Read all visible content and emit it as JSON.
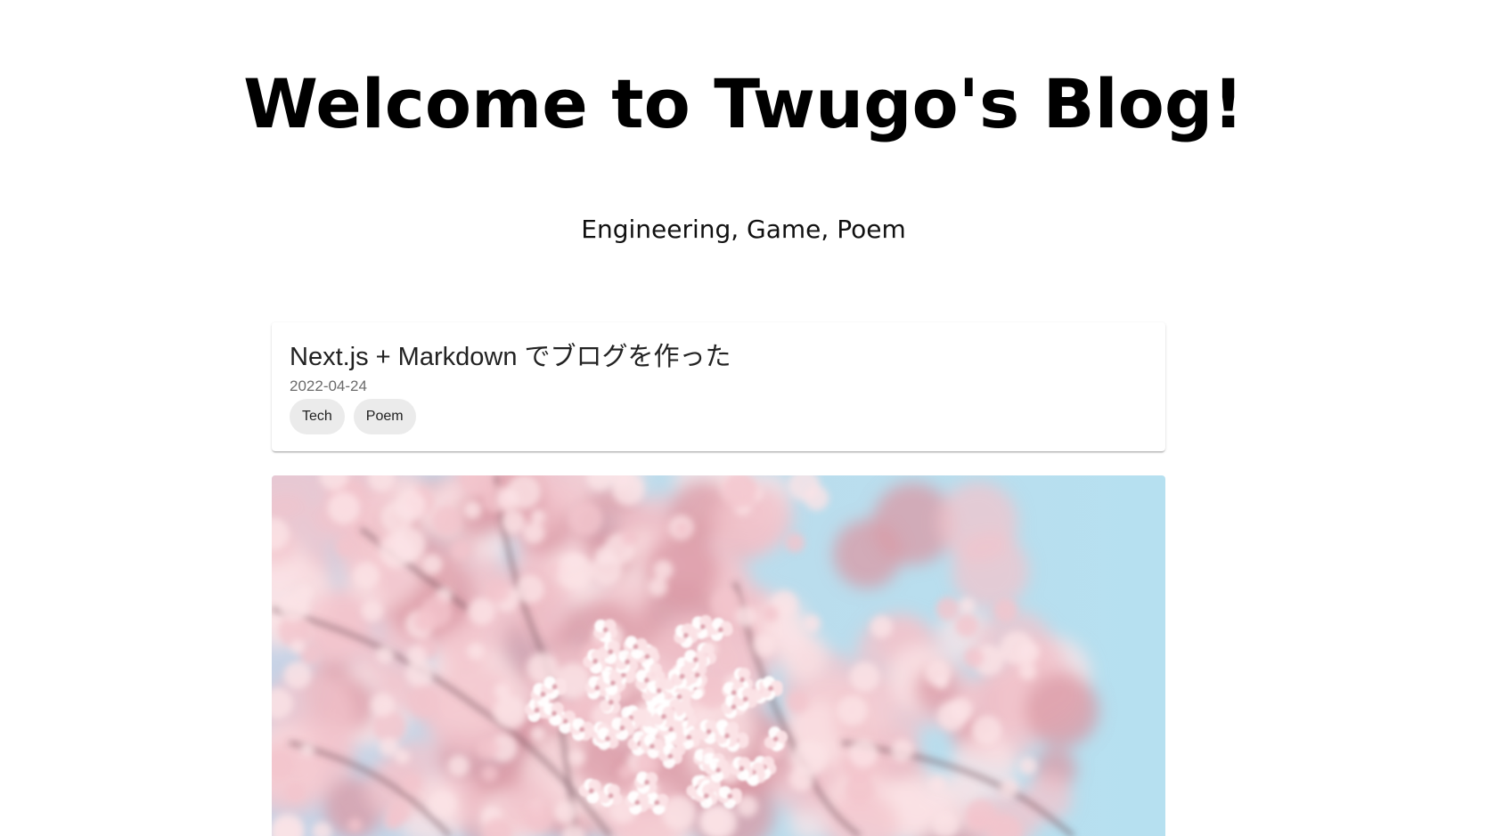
{
  "header": {
    "title": "Welcome to Twugo's Blog!",
    "subtitle": "Engineering, Game, Poem"
  },
  "posts": [
    {
      "title": "Next.js + Markdown でブログを作った",
      "date": "2022-04-24",
      "tags": [
        "Tech",
        "Poem"
      ]
    }
  ],
  "hero_image": {
    "subject": "cherry blossoms against blue sky",
    "colors": {
      "sky": "#b9dfee",
      "blossom": "#f2c4cc",
      "blossom_light": "#fbe3e6",
      "blossom_dark": "#d99aa6",
      "branch": "#6e4a55"
    }
  }
}
